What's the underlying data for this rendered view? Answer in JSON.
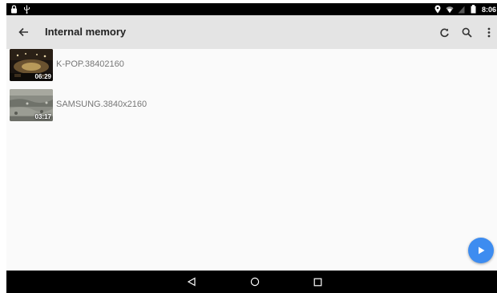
{
  "status_bar": {
    "time": "8:06",
    "left_icons": [
      "lock-icon",
      "usb-icon"
    ],
    "right_icons": [
      "location-icon",
      "wifi-icon",
      "signal-icon",
      "battery-icon"
    ]
  },
  "toolbar": {
    "title": "Internal memory",
    "back_icon": "arrow-back-icon",
    "actions": [
      "refresh-icon",
      "search-icon",
      "more-vert-icon"
    ]
  },
  "videos": [
    {
      "name": "K-POP.38402160",
      "duration": "06:29"
    },
    {
      "name": "SAMSUNG.3840x2160",
      "duration": "03:17"
    }
  ],
  "fab": {
    "icon": "play-icon",
    "color": "#3d8cf0"
  },
  "nav_bar": {
    "icons": [
      "nav-back-icon",
      "nav-home-icon",
      "nav-recent-icon"
    ]
  }
}
